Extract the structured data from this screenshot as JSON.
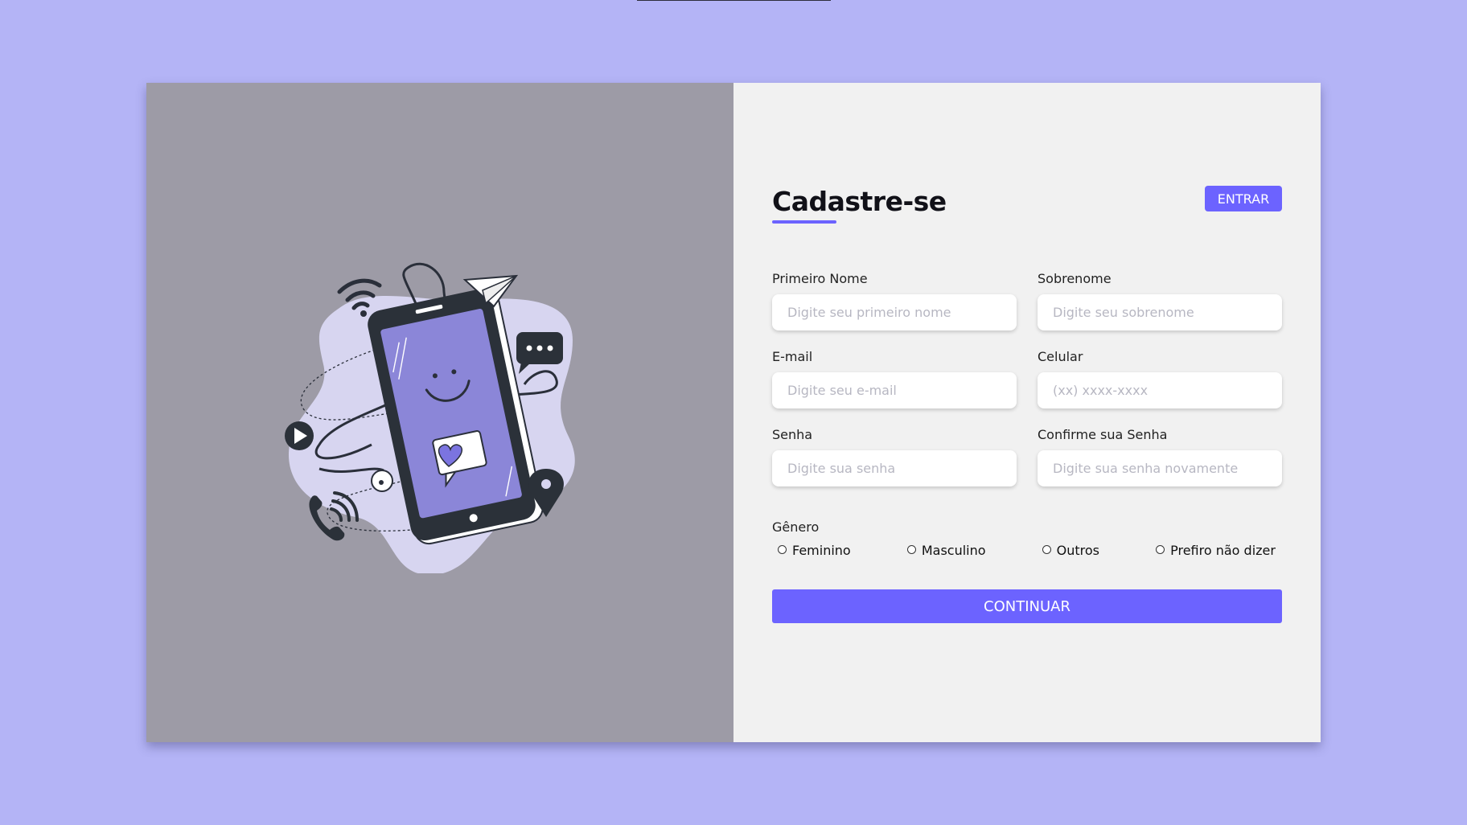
{
  "header": {
    "title": "Cadastre-se",
    "login_label": "ENTRAR"
  },
  "form": {
    "first_name": {
      "label": "Primeiro Nome",
      "placeholder": "Digite seu primeiro nome"
    },
    "last_name": {
      "label": "Sobrenome",
      "placeholder": "Digite seu sobrenome"
    },
    "email": {
      "label": "E-mail",
      "placeholder": "Digite seu e-mail"
    },
    "phone": {
      "label": "Celular",
      "placeholder": "(xx) xxxx-xxxx"
    },
    "password": {
      "label": "Senha",
      "placeholder": "Digite sua senha"
    },
    "confirm_password": {
      "label": "Confirme sua Senha",
      "placeholder": "Digite sua senha novamente"
    },
    "gender": {
      "label": "Gênero",
      "options": [
        "Feminino",
        "Masculino",
        "Outros",
        "Prefiro não dizer"
      ]
    },
    "submit_label": "CONTINUAR"
  },
  "colors": {
    "page_background": "#b4b4f6",
    "accent": "#6c63ff",
    "left_panel": "#9d9ba6",
    "right_panel": "#f1f1f1"
  },
  "icons": [
    "wifi-icon",
    "paper-plane-icon",
    "chat-bubble-icon",
    "play-icon",
    "phone-call-icon",
    "location-pin-icon",
    "heart-icon"
  ]
}
